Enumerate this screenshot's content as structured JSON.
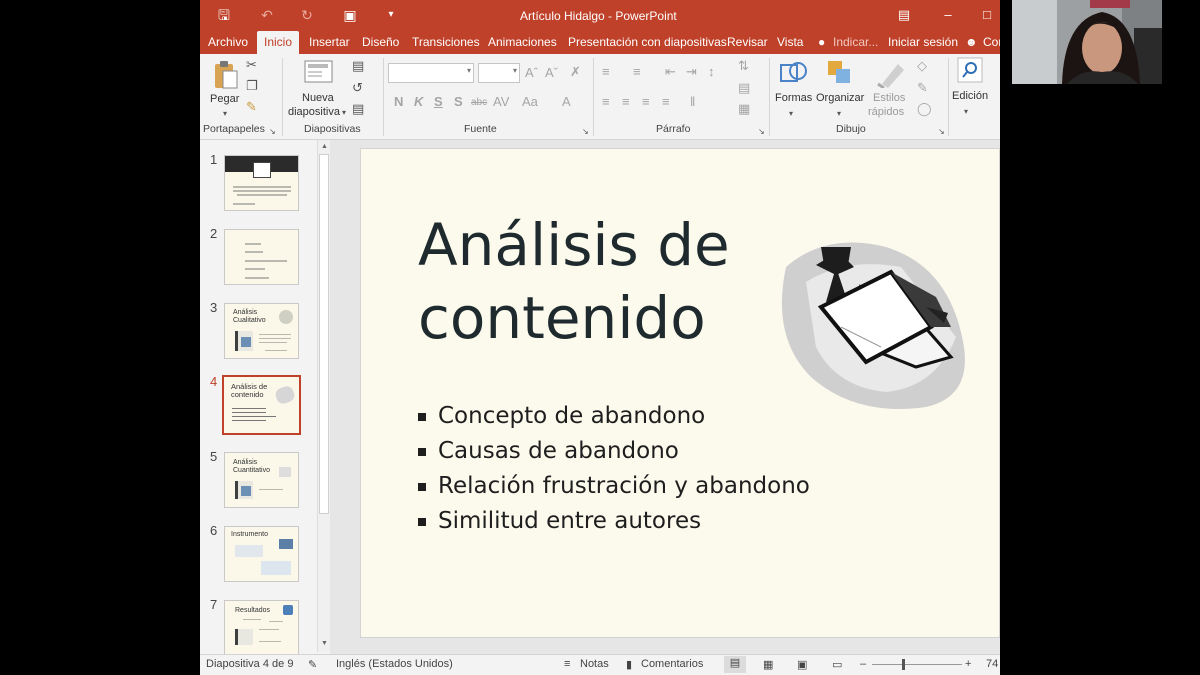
{
  "window": {
    "title": "Artículo Hidalgo - PowerPoint"
  },
  "tabs": [
    {
      "label": "Archivo"
    },
    {
      "label": "Inicio"
    },
    {
      "label": "Insertar"
    },
    {
      "label": "Diseño"
    },
    {
      "label": "Transiciones"
    },
    {
      "label": "Animaciones"
    },
    {
      "label": "Presentación con diapositivas"
    },
    {
      "label": "Revisar"
    },
    {
      "label": "Vista"
    },
    {
      "label": "Indicar..."
    },
    {
      "label": "Iniciar sesión"
    },
    {
      "label": "Cor"
    }
  ],
  "ribbon": {
    "paste_label": "Pegar",
    "new_slide_label_1": "Nueva",
    "new_slide_label_2": "diapositiva",
    "shapes_label": "Formas",
    "arrange_label": "Organizar",
    "quick_styles_label_1": "Estilos",
    "quick_styles_label_2": "rápidos",
    "editing_label": "Edición",
    "font_bold": "N",
    "font_italic": "K",
    "font_underline": "S",
    "font_shadow": "S",
    "font_strike": "abc",
    "groups": {
      "clipboard": "Portapapeles",
      "slides": "Diapositivas",
      "font": "Fuente",
      "paragraph": "Párrafo",
      "drawing": "Dibujo"
    }
  },
  "thumbnails": [
    {
      "num": "1"
    },
    {
      "num": "2"
    },
    {
      "num": "3",
      "title": "Análisis Cualitativo"
    },
    {
      "num": "4",
      "title": "Análisis de contenido"
    },
    {
      "num": "5",
      "title": "Análisis Cuantitativo"
    },
    {
      "num": "6",
      "title": "Instrumento"
    },
    {
      "num": "7",
      "title": "Resultados"
    }
  ],
  "slide": {
    "title_line1": "Análisis de",
    "title_line2": "contenido",
    "bullets": [
      "Concepto de abandono",
      "Causas de abandono",
      "Relación frustración y abandono",
      "Similitud entre autores"
    ]
  },
  "status": {
    "slide_indicator": "Diapositiva 4 de 9",
    "language": "Inglés (Estados Unidos)",
    "notes": "Notas",
    "comments": "Comentarios",
    "zoom": "74"
  },
  "colors": {
    "accent": "#c0412a",
    "slide_bg": "#fcfaed"
  }
}
